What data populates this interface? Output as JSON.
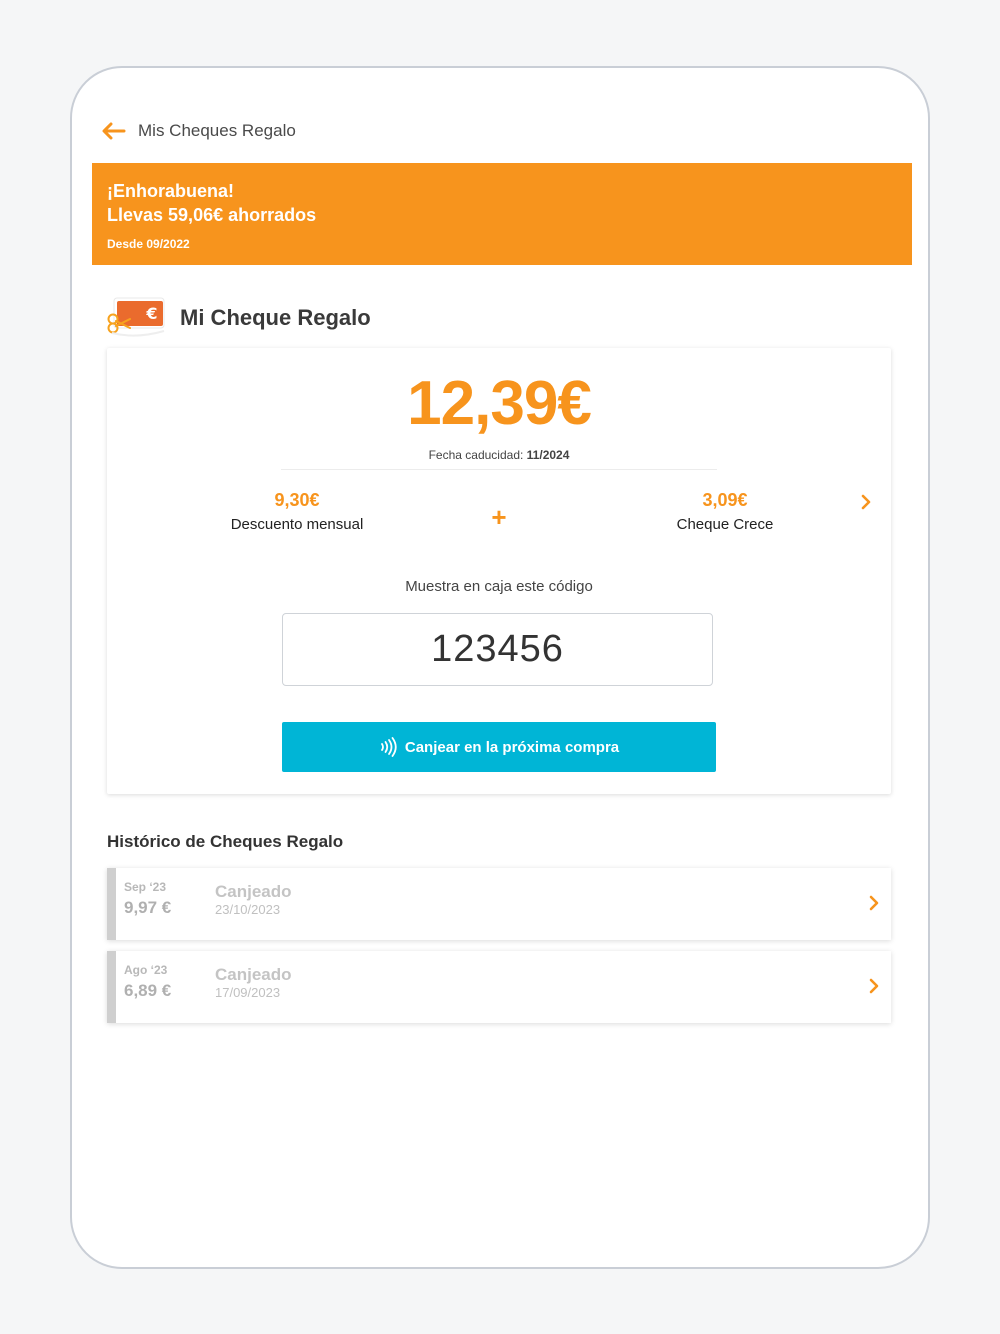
{
  "header": {
    "title": "Mis Cheques Regalo"
  },
  "banner": {
    "line1": "¡Enhorabuena!",
    "line2": "Llevas 59,06€ ahorrados",
    "since": "Desde 09/2022"
  },
  "cheque": {
    "section_title": "Mi Cheque Regalo",
    "amount": "12,39€",
    "expiry_label": "Fecha caducidad:",
    "expiry_value": "11/2024",
    "parts": [
      {
        "value": "9,30€",
        "label": "Descuento mensual"
      },
      {
        "value": "3,09€",
        "label": "Cheque Crece"
      }
    ],
    "plus": "+",
    "code_caption": "Muestra en caja este código",
    "code": "123456",
    "redeem_label": "Canjear en la próxima compra"
  },
  "history": {
    "title": "Histórico de Cheques Regalo",
    "items": [
      {
        "month": "Sep ‘23",
        "amount": "9,97 €",
        "status": "Canjeado",
        "date": "23/10/2023"
      },
      {
        "month": "Ago ‘23",
        "amount": "6,89 €",
        "status": "Canjeado",
        "date": "17/09/2023"
      }
    ]
  },
  "colors": {
    "brand_orange": "#f7941d",
    "action_blue": "#00b5d6",
    "muted_gray": "#cfcfcf"
  },
  "icons": {
    "back": "arrow-left-icon",
    "cheque": "gift-cheque-icon",
    "chevron": "chevron-right-icon",
    "contactless": "contactless-icon"
  }
}
